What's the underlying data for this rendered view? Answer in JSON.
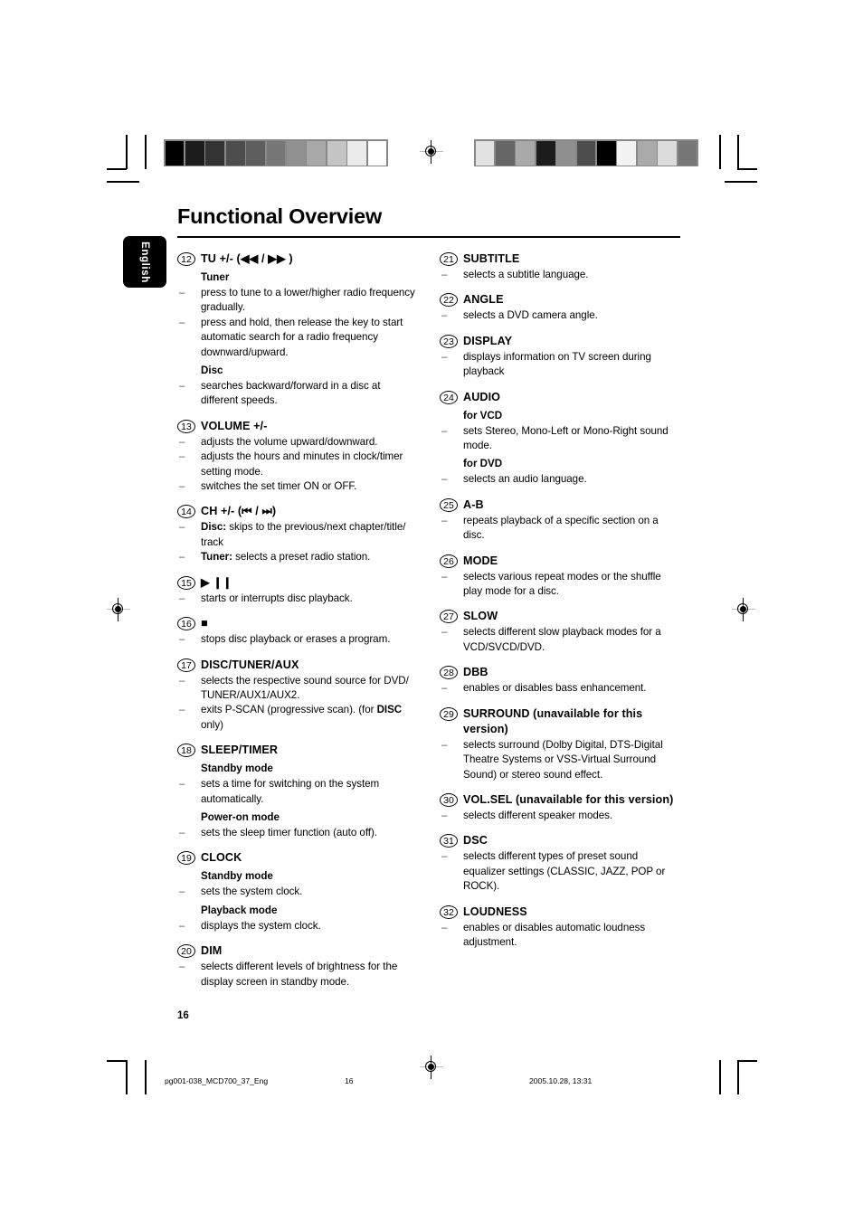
{
  "document": {
    "title": "Functional Overview",
    "language_tab": "English",
    "page_number": "16"
  },
  "footer": {
    "file": "pg001-038_MCD700_37_Eng",
    "page": "16",
    "date": "2005.10.28, 13:31"
  },
  "colorbars": {
    "left": [
      "#000000",
      "#1c1c1c",
      "#333333",
      "#4d4d4d",
      "#5e5e5e",
      "#777777",
      "#909090",
      "#a8a8a8",
      "#c4c4c4",
      "#ebebeb",
      "#ffffff"
    ],
    "right": [
      "#e2e2e2",
      "#666666",
      "#a9a9a9",
      "#1c1c1c",
      "#8f8f8f",
      "#4d4d4d",
      "#000000",
      "#f2f2f2",
      "#aaaaaa",
      "#dcdcdc",
      "#777777"
    ]
  },
  "left_column": [
    {
      "num": "12",
      "label": "TU +/- (◀◀ / ▶▶ )",
      "blocks": [
        {
          "type": "subhead",
          "text": "Tuner"
        },
        {
          "type": "bullet",
          "text": "press to tune to a lower/higher radio frequency gradually."
        },
        {
          "type": "bullet",
          "text": "press and hold, then release the key to start automatic search for a radio frequency downward/upward."
        },
        {
          "type": "subhead",
          "text": "Disc"
        },
        {
          "type": "bullet",
          "text": "searches backward/forward in a disc at different speeds."
        }
      ]
    },
    {
      "num": "13",
      "label": "VOLUME +/-",
      "blocks": [
        {
          "type": "bullet",
          "text": "adjusts the volume upward/downward."
        },
        {
          "type": "bullet",
          "text": "adjusts the hours and minutes in clock/timer setting mode."
        },
        {
          "type": "bullet",
          "text": "switches the set timer ON or OFF."
        }
      ]
    },
    {
      "num": "14",
      "label": "CH +/- (⏮ / ⏭)",
      "blocks": [
        {
          "type": "bullet_bold_lead",
          "lead": "Disc:",
          "text": " skips to the previous/next chapter/title/ track"
        },
        {
          "type": "bullet_bold_lead",
          "lead": "Tuner:",
          "text": " selects a preset radio station."
        }
      ]
    },
    {
      "num": "15",
      "label": "▶ ❙❙",
      "blocks": [
        {
          "type": "bullet",
          "text": "starts or interrupts disc playback."
        }
      ]
    },
    {
      "num": "16",
      "label": "■",
      "blocks": [
        {
          "type": "bullet",
          "text": "stops disc playback or erases a program."
        }
      ]
    },
    {
      "num": "17",
      "label": "DISC/TUNER/AUX",
      "blocks": [
        {
          "type": "bullet",
          "text": "selects the respective sound source for DVD/ TUNER/AUX1/AUX2."
        },
        {
          "type": "bullet_bold_inline",
          "pre": "exits P-SCAN (progressive scan). (for ",
          "bold": "DISC",
          "post": " only)"
        }
      ]
    },
    {
      "num": "18",
      "label": "SLEEP/TIMER",
      "blocks": [
        {
          "type": "subhead",
          "text": "Standby mode"
        },
        {
          "type": "bullet",
          "text": "sets a time for switching on the system automatically."
        },
        {
          "type": "subhead",
          "text": "Power-on mode"
        },
        {
          "type": "bullet",
          "text": "sets the sleep timer function (auto off)."
        }
      ]
    },
    {
      "num": "19",
      "label": "CLOCK",
      "blocks": [
        {
          "type": "subhead",
          "text": "Standby mode"
        },
        {
          "type": "bullet",
          "text": "sets the system clock."
        },
        {
          "type": "subhead",
          "text": "Playback mode"
        },
        {
          "type": "bullet",
          "text": "displays the system clock."
        }
      ]
    },
    {
      "num": "20",
      "label": "DIM",
      "blocks": [
        {
          "type": "bullet",
          "text": "selects different levels of brightness for the display screen in standby mode."
        }
      ]
    }
  ],
  "right_column": [
    {
      "num": "21",
      "label": "SUBTITLE",
      "blocks": [
        {
          "type": "bullet",
          "text": "selects a subtitle language."
        }
      ]
    },
    {
      "num": "22",
      "label": "ANGLE",
      "blocks": [
        {
          "type": "bullet",
          "text": "selects a DVD camera angle."
        }
      ]
    },
    {
      "num": "23",
      "label": "DISPLAY",
      "blocks": [
        {
          "type": "bullet",
          "text": "displays information on TV screen during playback"
        }
      ]
    },
    {
      "num": "24",
      "label": "AUDIO",
      "blocks": [
        {
          "type": "subhead",
          "text": "for VCD"
        },
        {
          "type": "bullet",
          "text": "sets Stereo, Mono-Left or Mono-Right sound mode."
        },
        {
          "type": "subhead",
          "text": "for DVD"
        },
        {
          "type": "bullet",
          "text": "selects an audio language."
        }
      ]
    },
    {
      "num": "25",
      "label": "A-B",
      "blocks": [
        {
          "type": "bullet",
          "text": "repeats playback of a specific section on a disc."
        }
      ]
    },
    {
      "num": "26",
      "label": "MODE",
      "blocks": [
        {
          "type": "bullet",
          "text": "selects various repeat modes or the shuffle play mode for a disc."
        }
      ]
    },
    {
      "num": "27",
      "label": "SLOW",
      "blocks": [
        {
          "type": "bullet",
          "text": "selects different slow playback modes for a VCD/SVCD/DVD."
        }
      ]
    },
    {
      "num": "28",
      "label": "DBB",
      "blocks": [
        {
          "type": "bullet",
          "text": "enables or disables bass enhancement."
        }
      ]
    },
    {
      "num": "29",
      "label": "SURROUND (unavailable for this version)",
      "blocks": [
        {
          "type": "bullet",
          "text": "selects surround (Dolby Digital, DTS-Digital Theatre Systems or VSS-Virtual Surround Sound) or stereo sound effect."
        }
      ]
    },
    {
      "num": "30",
      "label": "VOL.SEL (unavailable for this version)",
      "blocks": [
        {
          "type": "bullet",
          "text": "selects different speaker modes."
        }
      ]
    },
    {
      "num": "31",
      "label": "DSC",
      "blocks": [
        {
          "type": "bullet",
          "text": "selects different types of preset sound equalizer settings (CLASSIC, JAZZ, POP or ROCK)."
        }
      ]
    },
    {
      "num": "32",
      "label": "LOUDNESS",
      "blocks": [
        {
          "type": "bullet",
          "text": "enables or disables automatic loudness adjustment."
        }
      ]
    }
  ]
}
